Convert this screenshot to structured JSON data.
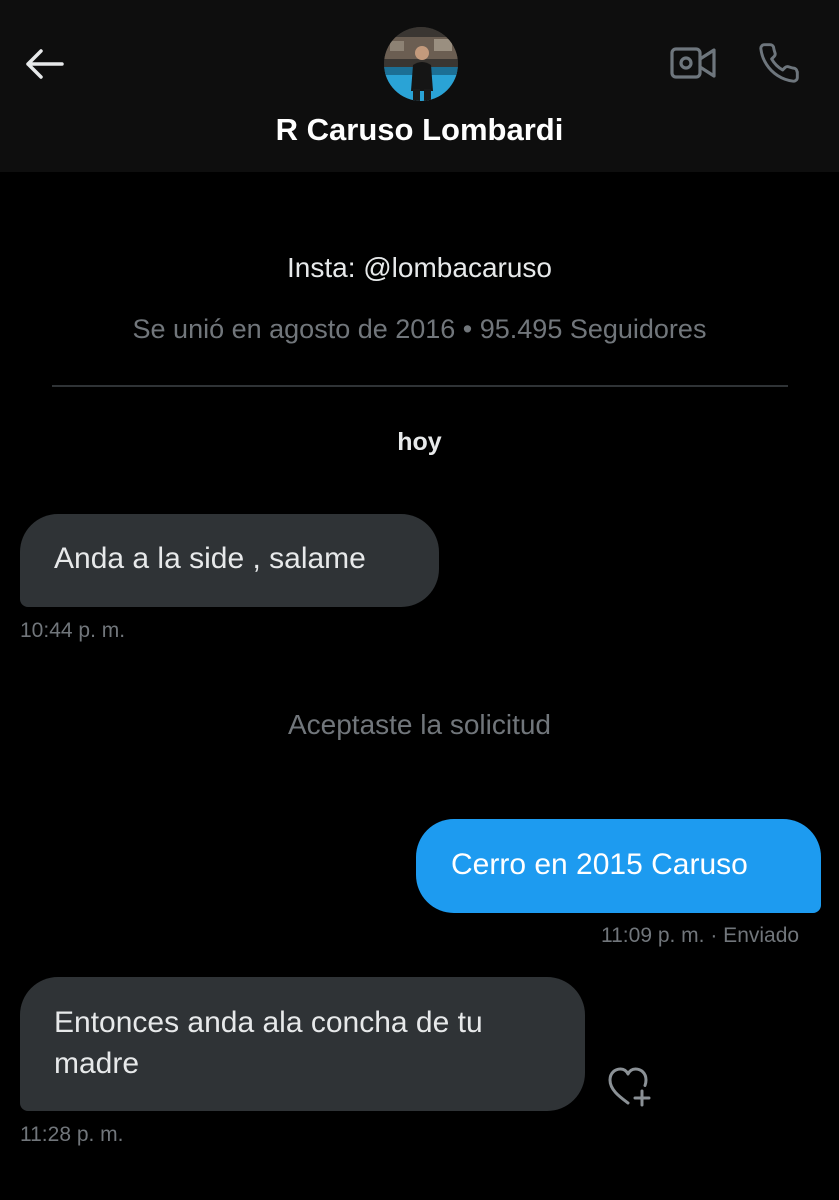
{
  "header": {
    "contact_name": "R Caruso Lombardi",
    "icons": {
      "back": "arrow-left-icon",
      "video": "video-camera-icon",
      "call": "phone-icon"
    }
  },
  "profile": {
    "bio": "Insta: @lombacaruso",
    "meta": "Se unió en agosto de 2016 • 95.495 Seguidores"
  },
  "conversation": {
    "day_label": "hoy",
    "system_message": "Aceptaste la solicitud",
    "messages": [
      {
        "direction": "received",
        "text": "Anda a la side , salame",
        "time": "10:44 p. m."
      },
      {
        "direction": "sent",
        "text": "Cerro en 2015 Caruso",
        "time": "11:09 p. m.",
        "status": "· Enviado"
      },
      {
        "direction": "received",
        "text": "Entonces anda ala concha de tu madre",
        "time": "11:28 p. m."
      }
    ]
  },
  "colors": {
    "background": "#000000",
    "header_bg": "#0e0e0e",
    "received_bubble": "#2f3336",
    "sent_bubble": "#1d9bf0",
    "muted_text": "#71767b"
  }
}
